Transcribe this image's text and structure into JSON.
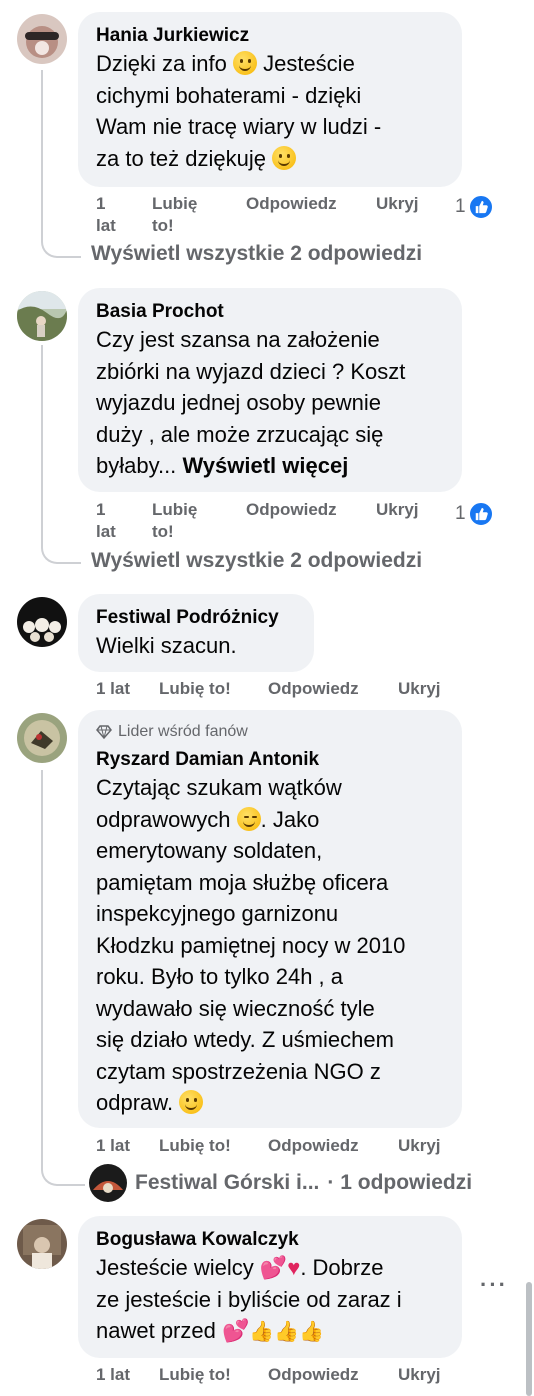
{
  "comments": [
    {
      "author": "Hania Jurkiewicz",
      "text_lines": [
        "Dzięki za info",
        "cichymi bohaterami - dzięki",
        "Wam nie tracę wiary w ludzi -",
        "za to też dziękuję"
      ],
      "text_mid": "Jesteście",
      "time": "1\nlat",
      "like": "Lubię\nto!",
      "reply": "Odpowiedz",
      "hide": "Ukryj",
      "reaction_count": "1",
      "view_replies": "Wyświetl wszystkie 2 odpowiedzi"
    },
    {
      "author": "Basia Prochot",
      "text": "Czy jest szansa na założenie\nzbiórki na wyjazd dzieci ? Koszt\nwyjazdu jednej osoby pewnie\nduży , ale może zrzucając się\nbyłaby...",
      "see_more": "Wyświetl więcej",
      "time": "1\nlat",
      "like": "Lubię\nto!",
      "reply": "Odpowiedz",
      "hide": "Ukryj",
      "reaction_count": "1",
      "view_replies": "Wyświetl wszystkie 2 odpowiedzi"
    },
    {
      "author": "Festiwal Podróżnicy",
      "text": "Wielki szacun.",
      "time": "1 lat",
      "like": "Lubię to!",
      "reply": "Odpowiedz",
      "hide": "Ukryj"
    },
    {
      "badge": "Lider wśród fanów",
      "author": "Ryszard Damian Antonik",
      "text_a": "Czytając szukam wątków\nodprawowych",
      "text_b": ". Jako\nemerytowany soldaten,\npamiętam moja służbę oficera\ninspekcyjnego garnizonu\nKłodzku pamiętnej nocy w 2010\nroku. Było to tylko 24h , a\nwydawało się wieczność tyle\nsię działo wtedy. Z uśmiechem\nczytam spostrzeżenia NGO z\nodpraw.",
      "time": "1 lat",
      "like": "Lubię to!",
      "reply": "Odpowiedz",
      "hide": "Ukryj",
      "reply_preview_name": "Festiwal Górski i...",
      "reply_preview_count": "· 1 odpowiedzi"
    },
    {
      "author": "Bogusława Kowalczyk",
      "text_a": "Jesteście wielcy",
      "text_b": ". Dobrze\nze jesteście i byliście od zaraz i\nnawet przed",
      "time": "1 lat",
      "like": "Lubię to!",
      "reply": "Odpowiedz",
      "hide": "Ukryj",
      "more_label": "···"
    }
  ],
  "colors": {
    "bubble": "#f0f2f5",
    "meta": "#65676b",
    "like_blue": "#1877f2",
    "line": "#ced0d4"
  }
}
